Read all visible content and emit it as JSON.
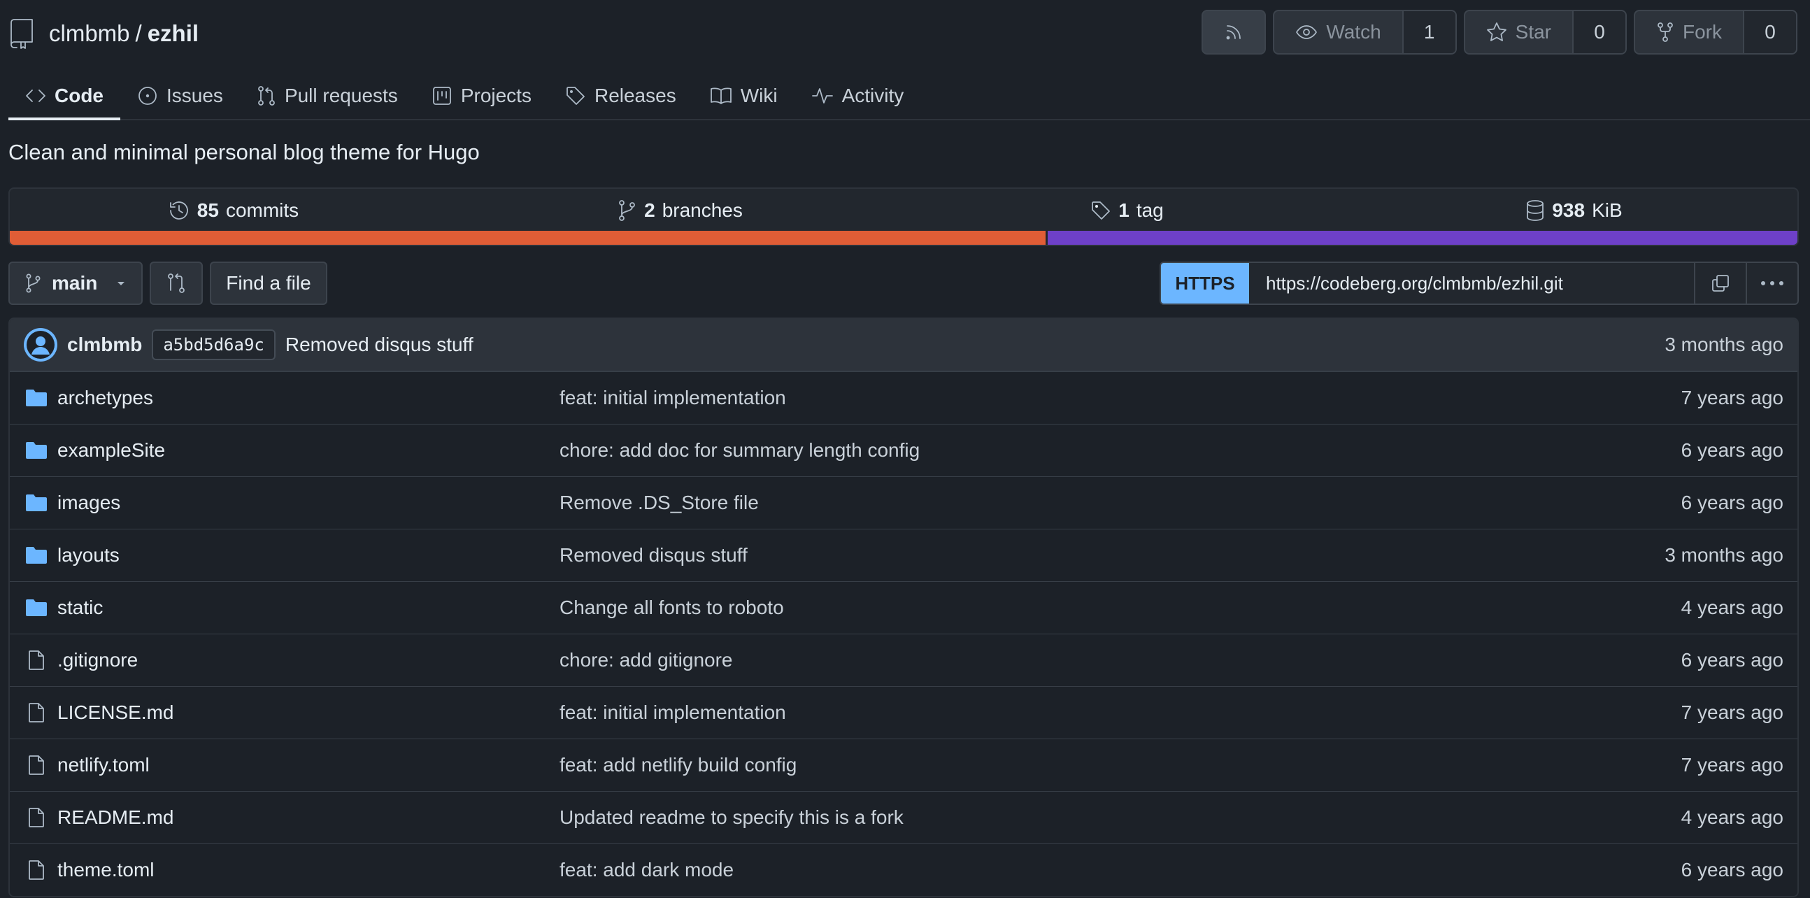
{
  "repo": {
    "owner": "clmbmb",
    "separator": "/",
    "name": "ezhil",
    "description": "Clean and minimal personal blog theme for Hugo"
  },
  "header_buttons": {
    "watch_label": "Watch",
    "watch_count": "1",
    "star_label": "Star",
    "star_count": "0",
    "fork_label": "Fork",
    "fork_count": "0"
  },
  "tabs": [
    {
      "label": "Code",
      "icon": "code-icon",
      "active": true
    },
    {
      "label": "Issues",
      "icon": "issue-icon"
    },
    {
      "label": "Pull requests",
      "icon": "pull-request-icon"
    },
    {
      "label": "Projects",
      "icon": "project-icon"
    },
    {
      "label": "Releases",
      "icon": "tag-icon"
    },
    {
      "label": "Wiki",
      "icon": "book-icon"
    },
    {
      "label": "Activity",
      "icon": "pulse-icon"
    }
  ],
  "stats": {
    "commits_count": "85",
    "commits_label": "commits",
    "branches_count": "2",
    "branches_label": "branches",
    "tags_count": "1",
    "tags_label": "tag",
    "size_value": "938",
    "size_unit": "KiB"
  },
  "languages": [
    {
      "color": "#e05d36",
      "share": 58
    },
    {
      "color": "#6e40c9",
      "share": 42
    }
  ],
  "toolbar": {
    "branch": "main",
    "find_file": "Find a file",
    "clone_protocol": "HTTPS",
    "clone_url": "https://codeberg.org/clmbmb/ezhil.git"
  },
  "latest_commit": {
    "author": "clmbmb",
    "sha": "a5bd5d6a9c",
    "message": "Removed disqus stuff",
    "time": "3 months ago"
  },
  "files": [
    {
      "type": "folder",
      "name": "archetypes",
      "message": "feat: initial implementation",
      "time": "7 years ago"
    },
    {
      "type": "folder",
      "name": "exampleSite",
      "message": "chore: add doc for summary length config",
      "time": "6 years ago"
    },
    {
      "type": "folder",
      "name": "images",
      "message": "Remove .DS_Store file",
      "time": "6 years ago"
    },
    {
      "type": "folder",
      "name": "layouts",
      "message": "Removed disqus stuff",
      "time": "3 months ago"
    },
    {
      "type": "folder",
      "name": "static",
      "message": "Change all fonts to roboto",
      "time": "4 years ago"
    },
    {
      "type": "file",
      "name": ".gitignore",
      "message": "chore: add gitignore",
      "time": "6 years ago"
    },
    {
      "type": "file",
      "name": "LICENSE.md",
      "message": "feat: initial implementation",
      "time": "7 years ago"
    },
    {
      "type": "file",
      "name": "netlify.toml",
      "message": "feat: add netlify build config",
      "time": "7 years ago"
    },
    {
      "type": "file",
      "name": "README.md",
      "message": "Updated readme to specify this is a fork",
      "time": "4 years ago"
    },
    {
      "type": "file",
      "name": "theme.toml",
      "message": "feat: add dark mode",
      "time": "6 years ago"
    }
  ]
}
